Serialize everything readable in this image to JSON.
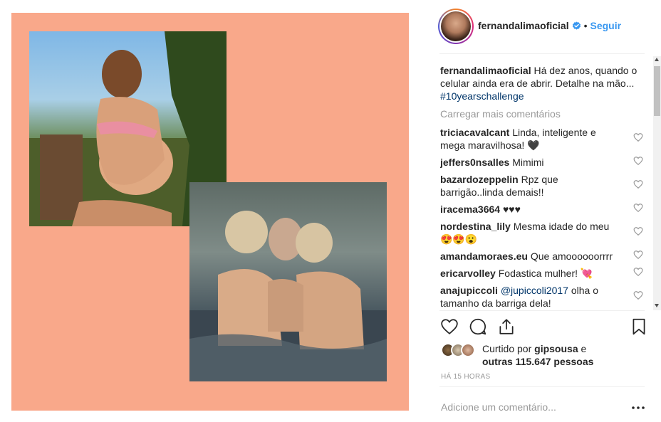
{
  "post": {
    "author": "fernandalimaoficial",
    "follow_label": "Seguir",
    "separator": "•",
    "verified": true,
    "background_color": "#f9a88a"
  },
  "caption": {
    "username": "fernandalimaoficial",
    "text": "Há dez anos, quando o celular ainda era de abrir. Detalhe na mão...",
    "hashtag": "#10yearschallenge"
  },
  "load_more_label": "Carregar mais comentários",
  "comments": [
    {
      "username": "triciacavalcant",
      "text": "Linda, inteligente e mega maravilhosa! 🖤"
    },
    {
      "username": "jeffers0nsalles",
      "text": "Mimimi"
    },
    {
      "username": "bazardozeppelin",
      "text": "Rpz que barrigão..linda demais!!"
    },
    {
      "username": "iracema3664",
      "text": "♥♥♥"
    },
    {
      "username": "nordestina_lily",
      "text": "Mesma idade do meu 😍😍😮"
    },
    {
      "username": "amandamoraes.eu",
      "text": "Que amoooooorrrr"
    },
    {
      "username": "ericarvolley",
      "text": "Fodastica mulher! 💘"
    },
    {
      "username": "anajupiccoli",
      "mention": "@jupiccoli2017",
      "text": "olha o tamanho da barriga dela!"
    }
  ],
  "likes": {
    "prefix": "Curtido por",
    "first_user": "gipsousa",
    "conjunction": "e",
    "others": "outras 115.647 pessoas"
  },
  "timestamp": "HÁ 15 HORAS",
  "add_comment_placeholder": "Adicione um comentário...",
  "colors": {
    "link_blue": "#3897f0",
    "hashtag_blue": "#003569",
    "muted_gray": "#999999"
  }
}
